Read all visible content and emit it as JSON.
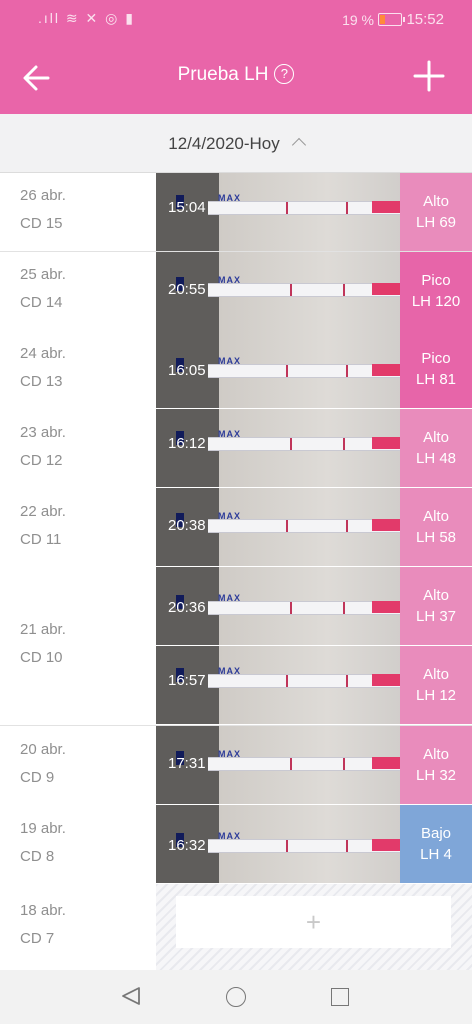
{
  "status_bar": {
    "battery": "19 %",
    "time": "15:52",
    "signal": "signal-wifi-icons"
  },
  "header": {
    "title": "Prueba LH",
    "help": "?",
    "bg_color": "#e965a9"
  },
  "date_range": {
    "label": "12/4/2020-Hoy"
  },
  "days": [
    {
      "date": "26 abr.",
      "cd": "CD 15"
    },
    {
      "date": "25 abr.",
      "cd": "CD 14"
    },
    {
      "date": "24 abr.",
      "cd": "CD 13"
    },
    {
      "date": "23 abr.",
      "cd": "CD 12"
    },
    {
      "date": "22 abr.",
      "cd": "CD 11"
    },
    {
      "date": "21 abr.",
      "cd": "CD 10"
    },
    {
      "date": "20 abr.",
      "cd": "CD 9"
    },
    {
      "date": "19 abr.",
      "cd": "CD 8"
    },
    {
      "date": "18 abr.",
      "cd": "CD 7"
    }
  ],
  "tests": [
    {
      "time": "15:04",
      "status": "Alto",
      "lh": "LH 69",
      "color": "#e98cbc"
    },
    {
      "time": "20:55",
      "status": "Pico",
      "lh": "LH 120",
      "color": "#e765a9"
    },
    {
      "time": "16:05",
      "status": "Pico",
      "lh": "LH 81",
      "color": "#e765a9"
    },
    {
      "time": "16:12",
      "status": "Alto",
      "lh": "LH 48",
      "color": "#e98cbc"
    },
    {
      "time": "20:38",
      "status": "Alto",
      "lh": "LH 58",
      "color": "#e98cbc"
    },
    {
      "time": "20:36",
      "status": "Alto",
      "lh": "LH 37",
      "color": "#e98cbc"
    },
    {
      "time": "16:57",
      "status": "Alto",
      "lh": "LH 12",
      "color": "#e98cbc"
    },
    {
      "time": "17:31",
      "status": "Alto",
      "lh": "LH 32",
      "color": "#e98cbc"
    },
    {
      "time": "16:32",
      "status": "Bajo",
      "lh": "LH 4",
      "color": "#7fa6d8"
    }
  ],
  "strip_text": "MAX",
  "empty": {
    "add": "+"
  }
}
